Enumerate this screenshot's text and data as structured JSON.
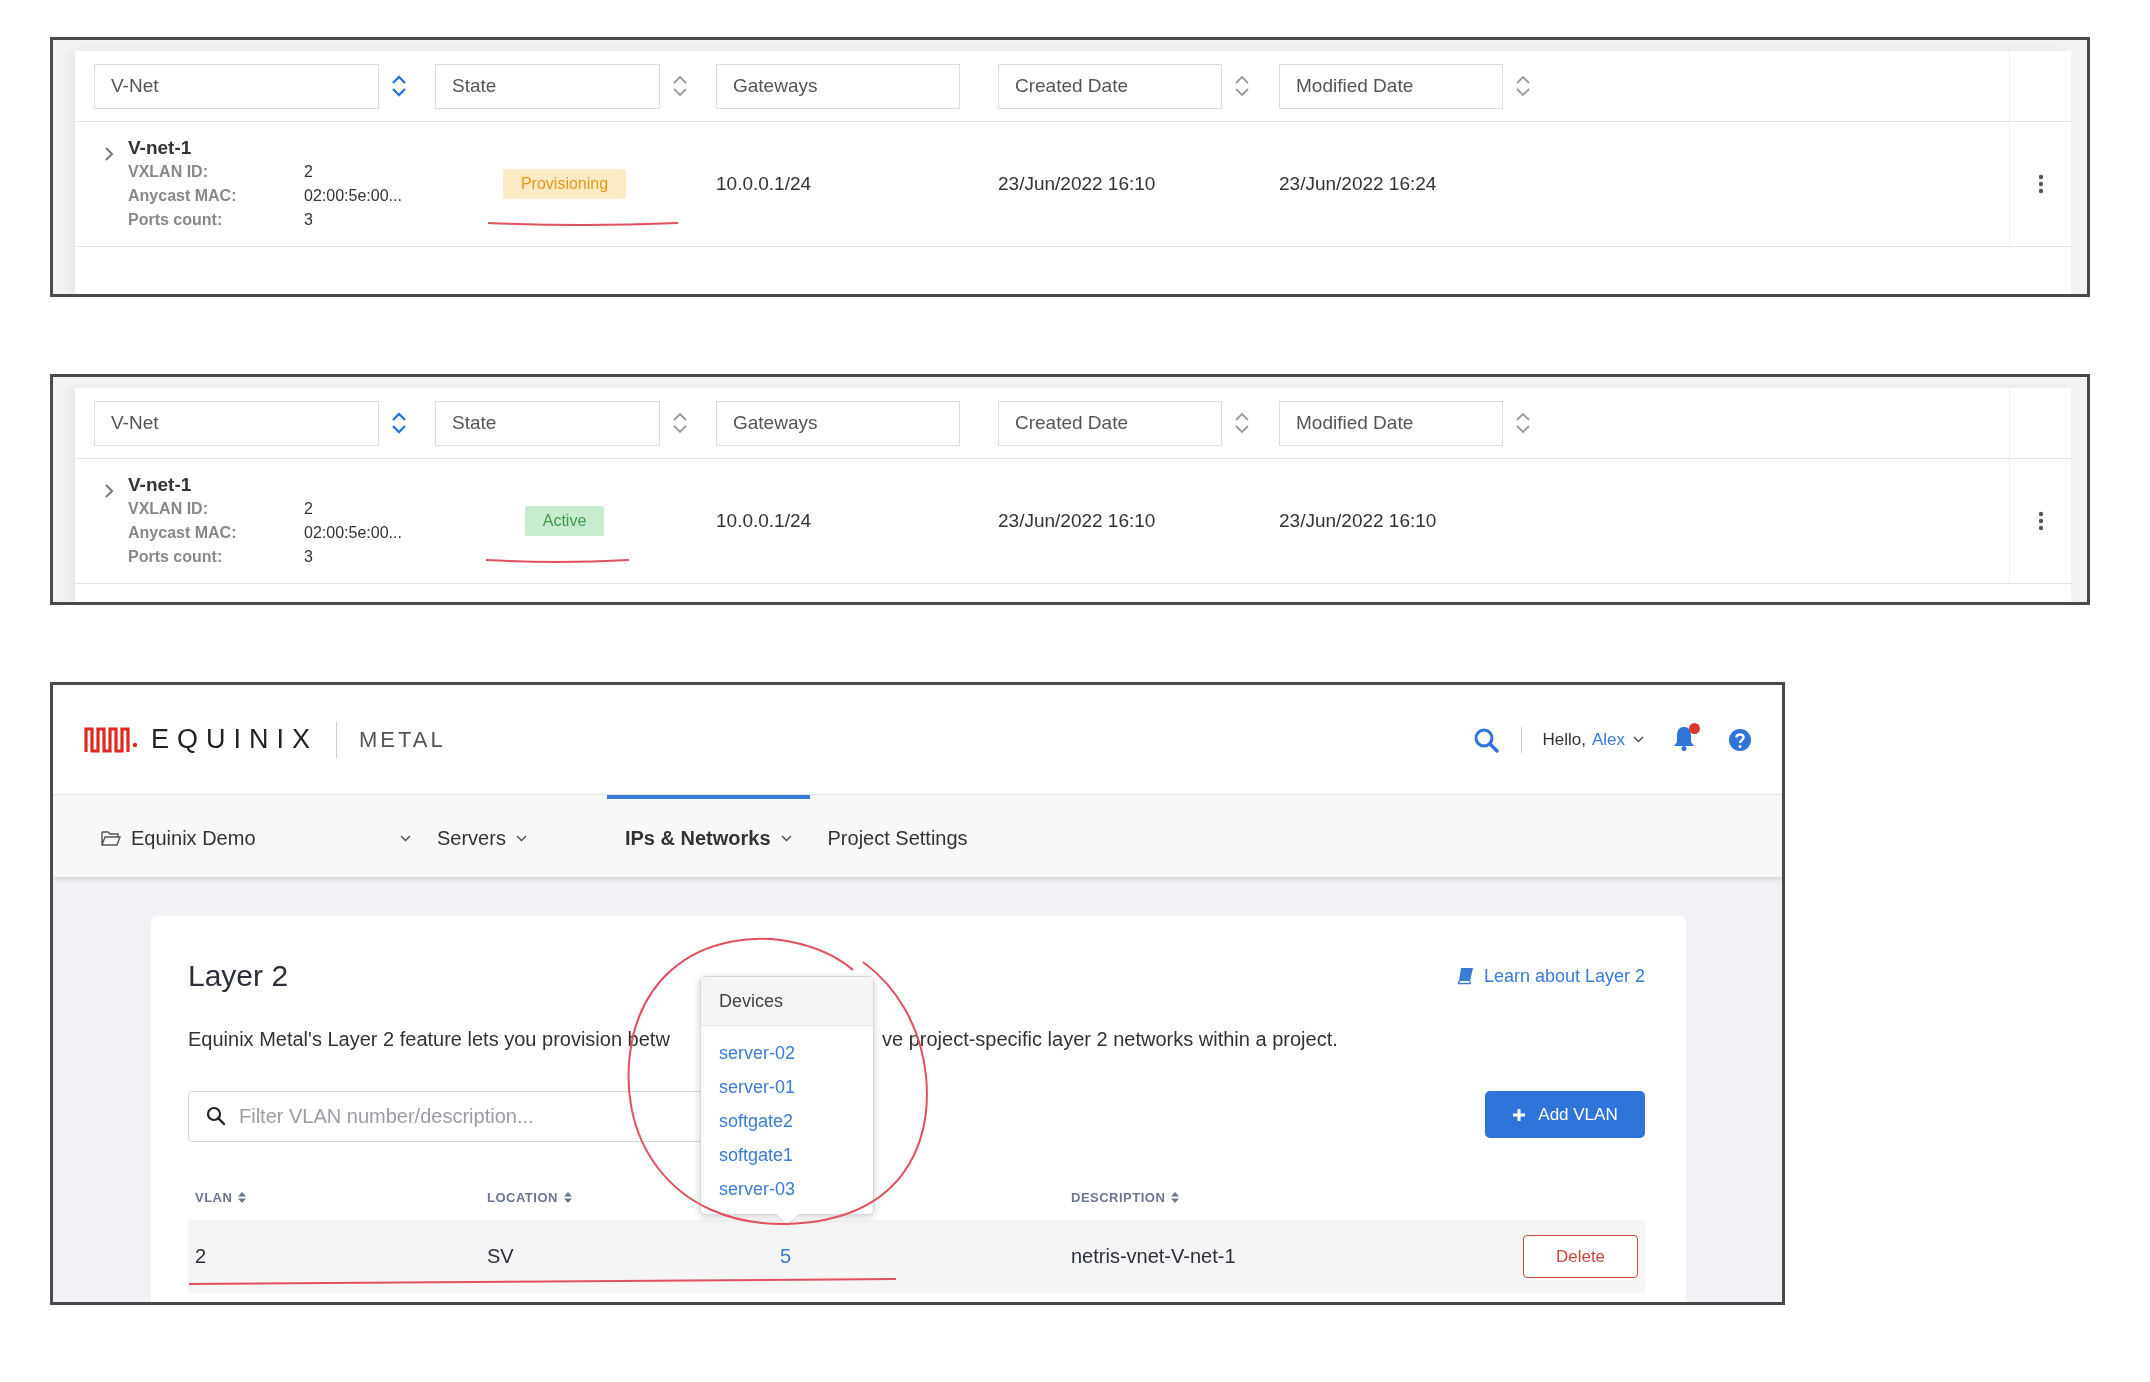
{
  "vnet_tables": [
    {
      "columns": [
        {
          "label": "V-Net",
          "sortable": true,
          "sort_active": true
        },
        {
          "label": "State",
          "sortable": true,
          "sort_active": false
        },
        {
          "label": "Gateways",
          "sortable": false
        },
        {
          "label": "Created Date",
          "sortable": true,
          "sort_active": false
        },
        {
          "label": "Modified Date",
          "sortable": true,
          "sort_active": false
        }
      ],
      "rows": [
        {
          "name": "V-net-1",
          "expanded": false,
          "details": [
            {
              "label": "VXLAN ID:",
              "value": "2"
            },
            {
              "label": "Anycast MAC:",
              "value": "02:00:5e:00..."
            },
            {
              "label": "Ports count:",
              "value": "3"
            }
          ],
          "state": {
            "label": "Provisioning",
            "kind": "warning"
          },
          "gateways": "10.0.0.1/24",
          "created": "23/Jun/2022 16:10",
          "modified": "23/Jun/2022 16:24"
        }
      ]
    },
    {
      "columns": [
        {
          "label": "V-Net",
          "sortable": true,
          "sort_active": true
        },
        {
          "label": "State",
          "sortable": true,
          "sort_active": false
        },
        {
          "label": "Gateways",
          "sortable": false
        },
        {
          "label": "Created Date",
          "sortable": true,
          "sort_active": false
        },
        {
          "label": "Modified Date",
          "sortable": true,
          "sort_active": false
        }
      ],
      "rows": [
        {
          "name": "V-net-1",
          "expanded": false,
          "details": [
            {
              "label": "VXLAN ID:",
              "value": "2"
            },
            {
              "label": "Anycast MAC:",
              "value": "02:00:5e:00..."
            },
            {
              "label": "Ports count:",
              "value": "3"
            }
          ],
          "state": {
            "label": "Active",
            "kind": "success"
          },
          "gateways": "10.0.0.1/24",
          "created": "23/Jun/2022 16:10",
          "modified": "23/Jun/2022 16:10"
        }
      ]
    }
  ],
  "metal_app": {
    "brand": {
      "name": "EQUINIX",
      "product": "METAL"
    },
    "user": {
      "greeting": "Hello,",
      "name": "Alex"
    },
    "notifications": {
      "unread": true
    },
    "nav": [
      {
        "label": "Equinix Demo",
        "kind": "project",
        "selected": false
      },
      {
        "label": "Servers",
        "kind": "menu",
        "selected": false
      },
      {
        "label": "IPs & Networks",
        "kind": "menu",
        "selected": true
      },
      {
        "label": "Project Settings",
        "kind": "link",
        "selected": false
      }
    ],
    "page": {
      "title": "Layer 2",
      "learn_link": "Learn about Layer 2",
      "description_fragments": [
        "Equinix Metal's Layer 2 feature lets you provision betw",
        "ve project-specific layer 2 networks within a project."
      ],
      "search": {
        "placeholder": "Filter VLAN number/description..."
      },
      "add_button": "Add VLAN",
      "columns": [
        {
          "label": "VLAN"
        },
        {
          "label": "LOCATION"
        },
        {
          "label": "DESCRIPTION"
        }
      ],
      "rows": [
        {
          "vlan": "2",
          "location": "SV",
          "devices_count": "5",
          "description": "netris-vnet-V-net-1",
          "action": "Delete"
        }
      ],
      "popover": {
        "title": "Devices",
        "items": [
          "server-02",
          "server-01",
          "softgate2",
          "softgate1",
          "server-03"
        ]
      }
    }
  }
}
